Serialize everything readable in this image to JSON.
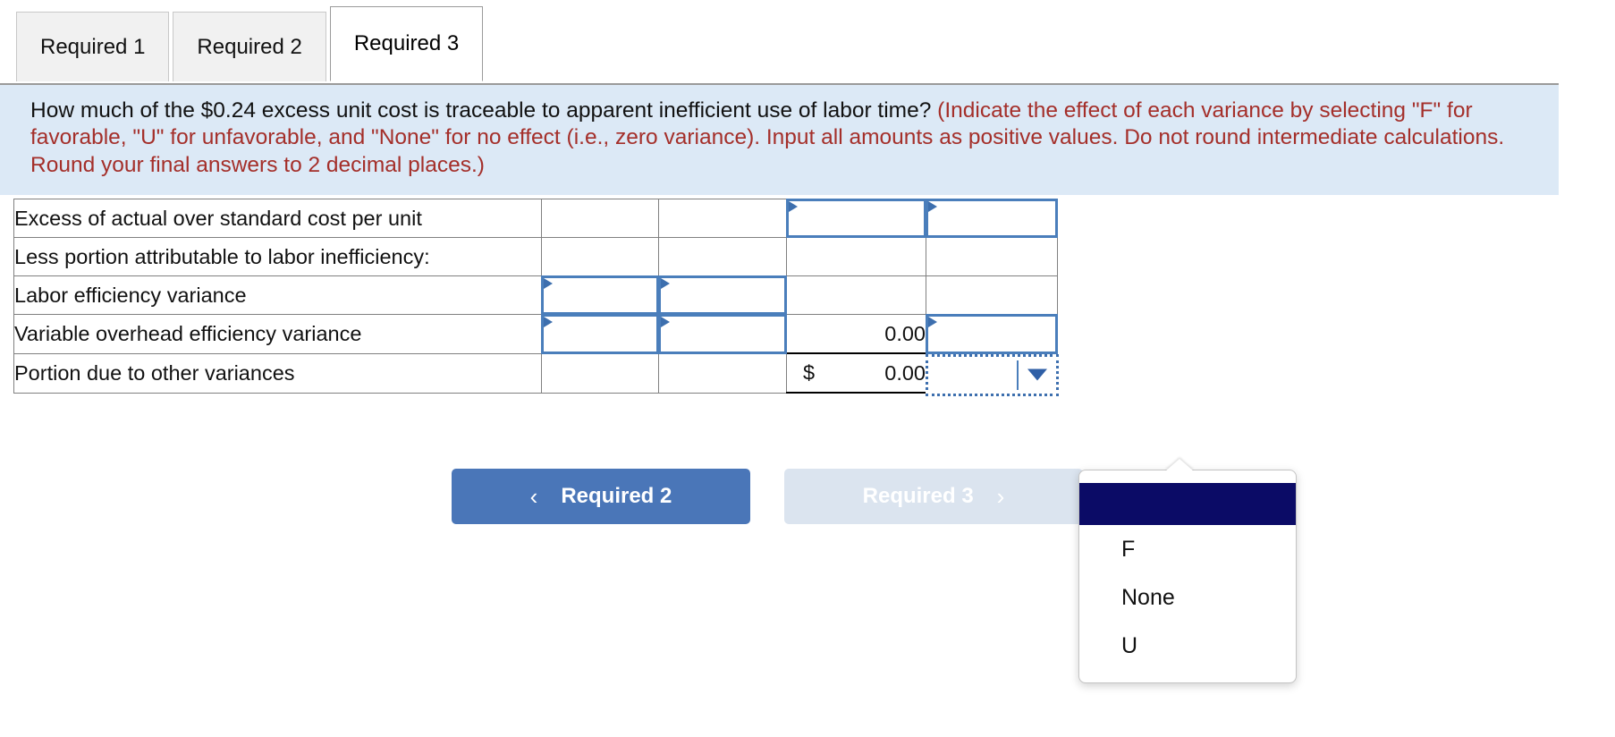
{
  "tabs": [
    {
      "label": "Required 1",
      "active": false
    },
    {
      "label": "Required 2",
      "active": false
    },
    {
      "label": "Required 3",
      "active": true
    }
  ],
  "question": {
    "main": "How much of the $0.24 excess unit cost is traceable to apparent inefficient use of labor time?",
    "hint": "(Indicate the effect of each variance by selecting \"F\" for favorable, \"U\" for unfavorable, and \"None\" for no effect (i.e., zero variance). Input all amounts as positive values. Do not round intermediate calculations. Round your final answers to 2 decimal places.)",
    "background_color": "#dce9f6",
    "hint_color": "#a42f2a"
  },
  "table": {
    "rows": [
      {
        "label": "Excess of actual over standard cost per unit",
        "col_a": "",
        "col_b": "",
        "col_c": "",
        "col_d": ""
      },
      {
        "label": "Less portion attributable to labor inefficiency:",
        "col_a": "",
        "col_b": "",
        "col_c": "",
        "col_d": ""
      },
      {
        "label": "Labor efficiency variance",
        "col_a": "",
        "col_b": "",
        "col_c": "",
        "col_d": ""
      },
      {
        "label": "Variable overhead efficiency variance",
        "col_a": "",
        "col_b": "",
        "col_c": "0.00",
        "col_d": ""
      },
      {
        "label": "Portion due to other variances",
        "col_a": "",
        "col_b": "",
        "col_c_currency": "$",
        "col_c": "0.00",
        "col_d": ""
      }
    ]
  },
  "dropdown": {
    "selected": "",
    "options": [
      "",
      "F",
      "None",
      "U"
    ],
    "highlight_color": "#0b0b66"
  },
  "nav": {
    "prev_label": "Required 2",
    "prev_icon": "chevron-left-icon",
    "next_label": "Required 3",
    "next_icon": "chevron-right-icon",
    "prev_color": "#4a76b8",
    "next_color": "#dbe4ef"
  }
}
